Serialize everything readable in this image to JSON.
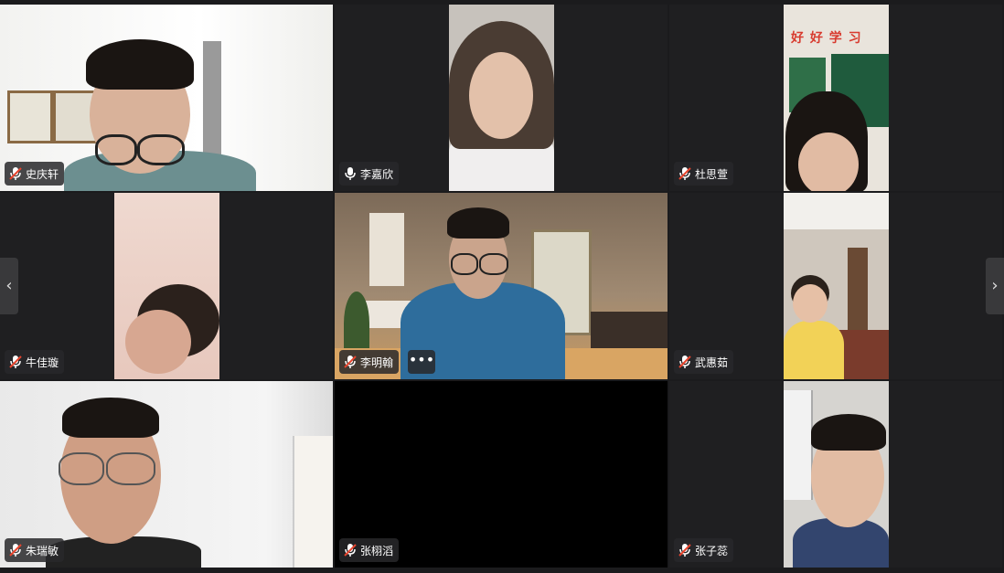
{
  "participants": [
    {
      "name": "史庆轩",
      "muted": true
    },
    {
      "name": "李嘉欣",
      "muted": false
    },
    {
      "name": "杜思萱",
      "muted": true
    },
    {
      "name": "牛佳璇",
      "muted": true
    },
    {
      "name": "李明翰",
      "muted": true
    },
    {
      "name": "武惠茹",
      "muted": true
    },
    {
      "name": "朱瑞敏",
      "muted": true
    },
    {
      "name": "张栩滔",
      "muted": true
    },
    {
      "name": "张子蕊",
      "muted": true
    }
  ],
  "classroom_sign": "好 好 学 习",
  "controls": {
    "more": "•••",
    "prev": "‹",
    "next": "›"
  },
  "colors": {
    "mic_muted": "#e8452e",
    "tag_bg": "#28282a"
  }
}
